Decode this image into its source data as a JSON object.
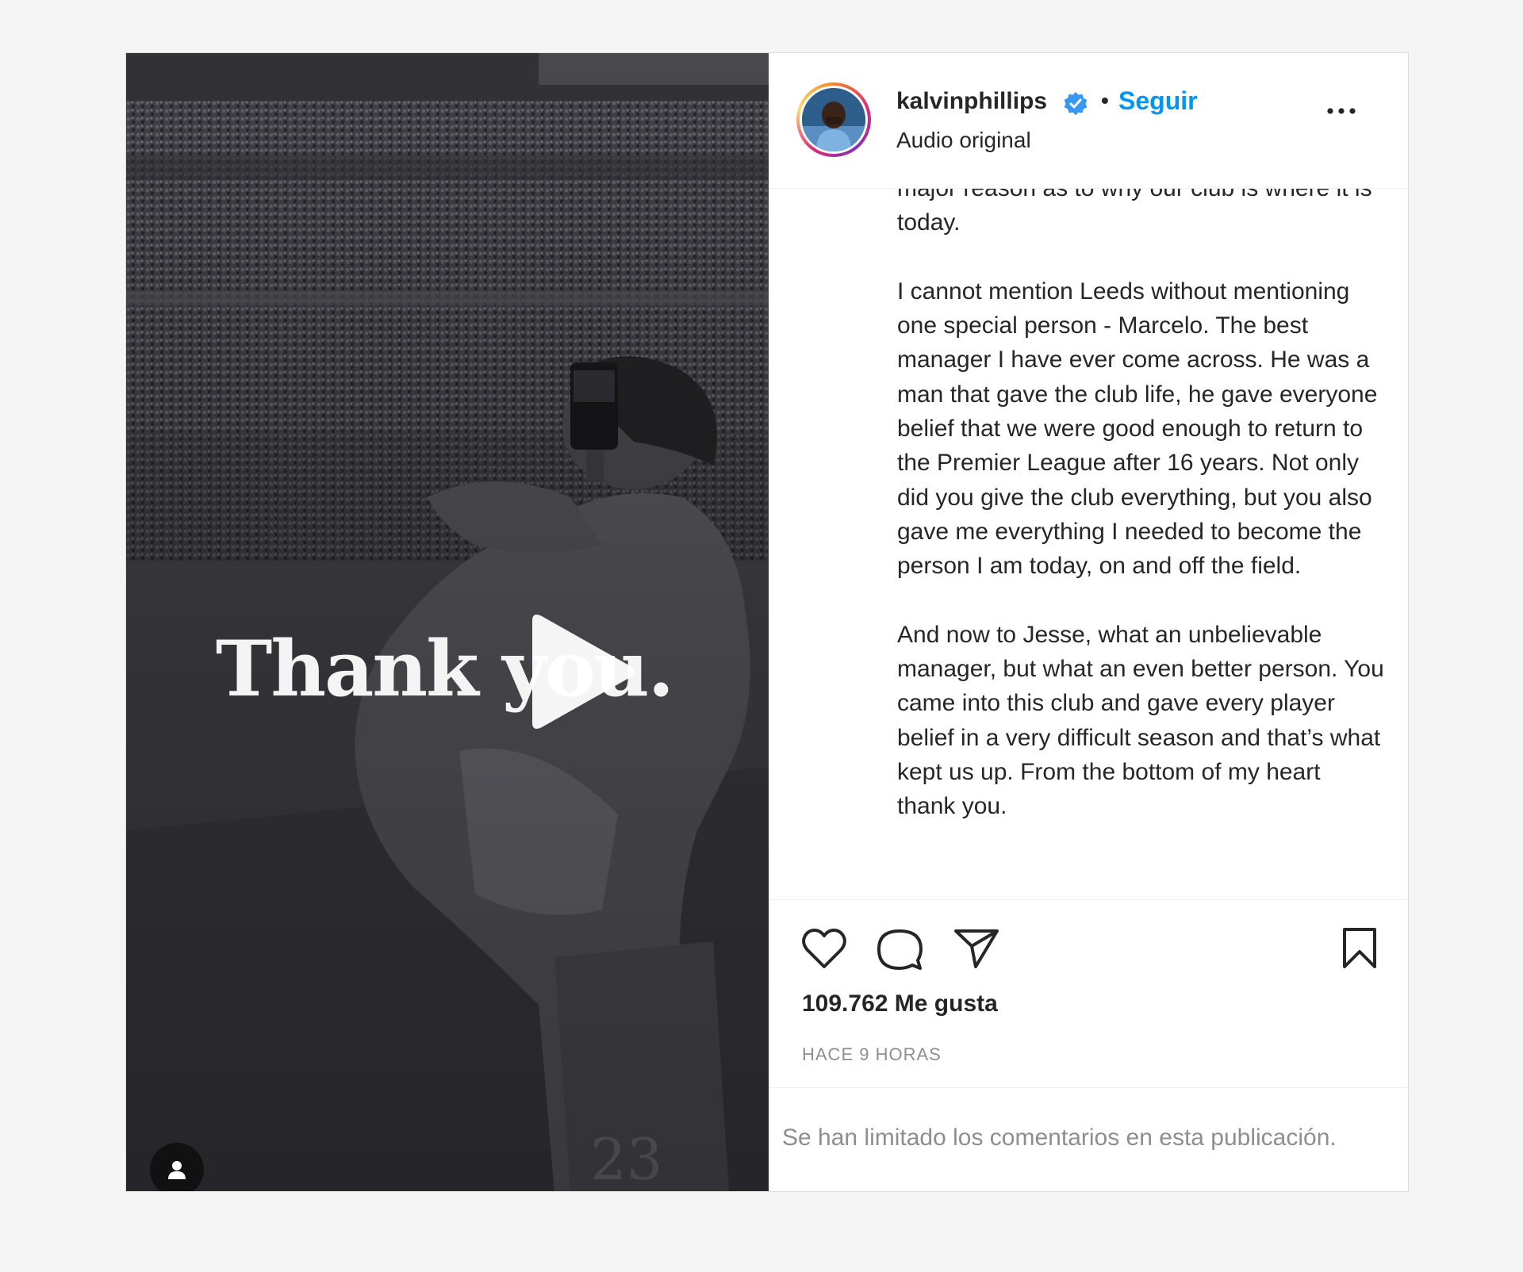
{
  "media": {
    "overlay_text": "Thank you.",
    "jersey_number": "23"
  },
  "header": {
    "username": "kalvinphillips",
    "separator": "•",
    "follow_label": "Seguir",
    "audio_label": "Audio original"
  },
  "caption": {
    "paragraphs": [
      "major reason as to why our club is where it is today.",
      "I cannot mention Leeds without mentioning one special person - Marcelo. The best manager I have ever come across. He was a man that gave the club life, he gave everyone belief that we were good enough to return to the Premier League after 16 years. Not only did you give the club everything, but you also gave me everything I needed to become the person I am today, on and off the field.",
      "And now to Jesse, what an unbelievable manager, but what an even better person. You came into this club and gave every player belief in a very difficult season and that’s what kept us up. From the bottom of my heart thank you."
    ]
  },
  "stats": {
    "likes": "109.762 Me gusta",
    "time_ago": "HACE 9 HORAS"
  },
  "comments": {
    "limited_notice": "Se han limitado los comentarios en esta publicación."
  },
  "icons": {
    "like": "heart-icon",
    "comment": "comment-icon",
    "share": "share-icon",
    "save": "bookmark-icon",
    "more": "more-options-icon",
    "verified": "verified-badge-icon",
    "play": "play-icon",
    "tags": "user-tag-icon"
  },
  "colors": {
    "link_blue": "#0095f6",
    "text": "#262626",
    "muted": "#8e8e8e",
    "verified_blue": "#3897f0"
  }
}
